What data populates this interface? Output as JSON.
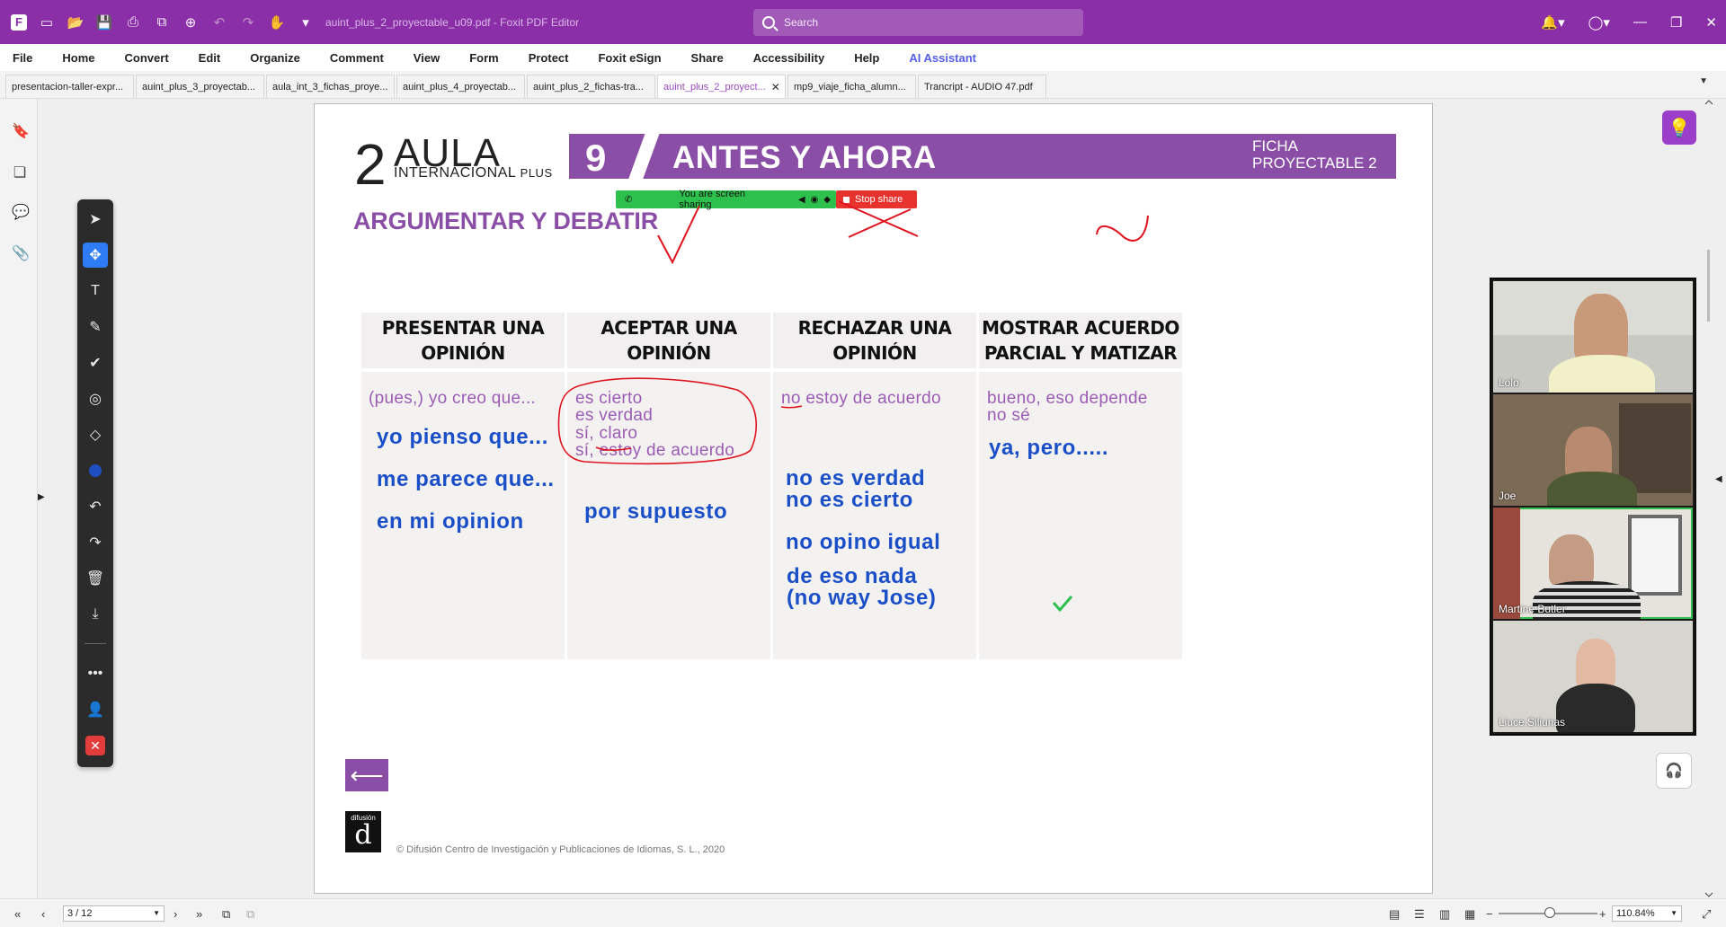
{
  "titlebar": {
    "doc_title": "auint_plus_2_proyectable_u09.pdf - Foxit PDF Editor",
    "search_placeholder": "Search"
  },
  "menu": [
    "File",
    "Home",
    "Convert",
    "Edit",
    "Organize",
    "Comment",
    "View",
    "Form",
    "Protect",
    "Foxit eSign",
    "Share",
    "Accessibility",
    "Help",
    "AI Assistant"
  ],
  "tabs": [
    {
      "label": "presentacion-taller-expr...",
      "active": false
    },
    {
      "label": "auint_plus_3_proyectab...",
      "active": false
    },
    {
      "label": "aula_int_3_fichas_proye...",
      "active": false
    },
    {
      "label": "auint_plus_4_proyectab...",
      "active": false
    },
    {
      "label": "auint_plus_2_fichas-tra...",
      "active": false
    },
    {
      "label": "auint_plus_2_proyect...",
      "active": true
    },
    {
      "label": "mp9_viaje_ficha_alumn...",
      "active": false
    },
    {
      "label": "Trancript - AUDIO 47.pdf",
      "active": false
    }
  ],
  "document": {
    "logo_number": "2",
    "logo_word": "AULA",
    "logo_sub_1": "INTERNACIONAL",
    "logo_sub_2": "PLUS",
    "banner_number": "9",
    "banner_title": "ANTES Y AHORA",
    "banner_ficha_1": "FICHA",
    "banner_ficha_2": "PROYECTABLE 2",
    "section_title": "ARGUMENTAR Y DEBATIR",
    "columns": [
      {
        "header": "PRESENTAR UNA OPINIÓN"
      },
      {
        "header": "ACEPTAR UNA OPINIÓN"
      },
      {
        "header": "RECHAZAR UNA OPINIÓN"
      },
      {
        "header": "MOSTRAR ACUERDO PARCIAL Y MATIZAR"
      }
    ],
    "col1_printed": "(pues,) yo creo que...",
    "col1_typed": [
      "yo pienso que...",
      "me parece que...",
      "en mi opinion"
    ],
    "col2_printed": [
      "es cierto",
      "es verdad",
      "sí, claro",
      "sí, estoy de acuerdo"
    ],
    "col2_typed": [
      "por supuesto"
    ],
    "col3_printed": "no estoy de acuerdo",
    "col3_typed": [
      "no es verdad",
      "no es cierto",
      "no opino igual",
      "de eso nada",
      "(no way Jose)"
    ],
    "col4_printed": [
      "bueno, eso depende",
      "no sé"
    ],
    "col4_typed": [
      "ya, pero....."
    ],
    "publisher_logo_text": "difusión",
    "publisher_logo_letter": "d",
    "copyright": "© Difusión Centro de Investigación y Publicaciones de Idiomas, S. L., 2020"
  },
  "screen_share": {
    "status": "You are screen sharing",
    "stop_label": "Stop share"
  },
  "participants": [
    "Lolo",
    "Joe",
    "Martine Butler",
    "Liuce.Siliunas"
  ],
  "statusbar": {
    "page": "3 / 12",
    "zoom": "110.84%"
  },
  "colors": {
    "brand_purple": "#8b2fa8",
    "doc_purple": "#8a4ea6",
    "typed_blue": "#1b4fc8",
    "annotation_red": "#e0141e",
    "share_green": "#2ec04c"
  }
}
